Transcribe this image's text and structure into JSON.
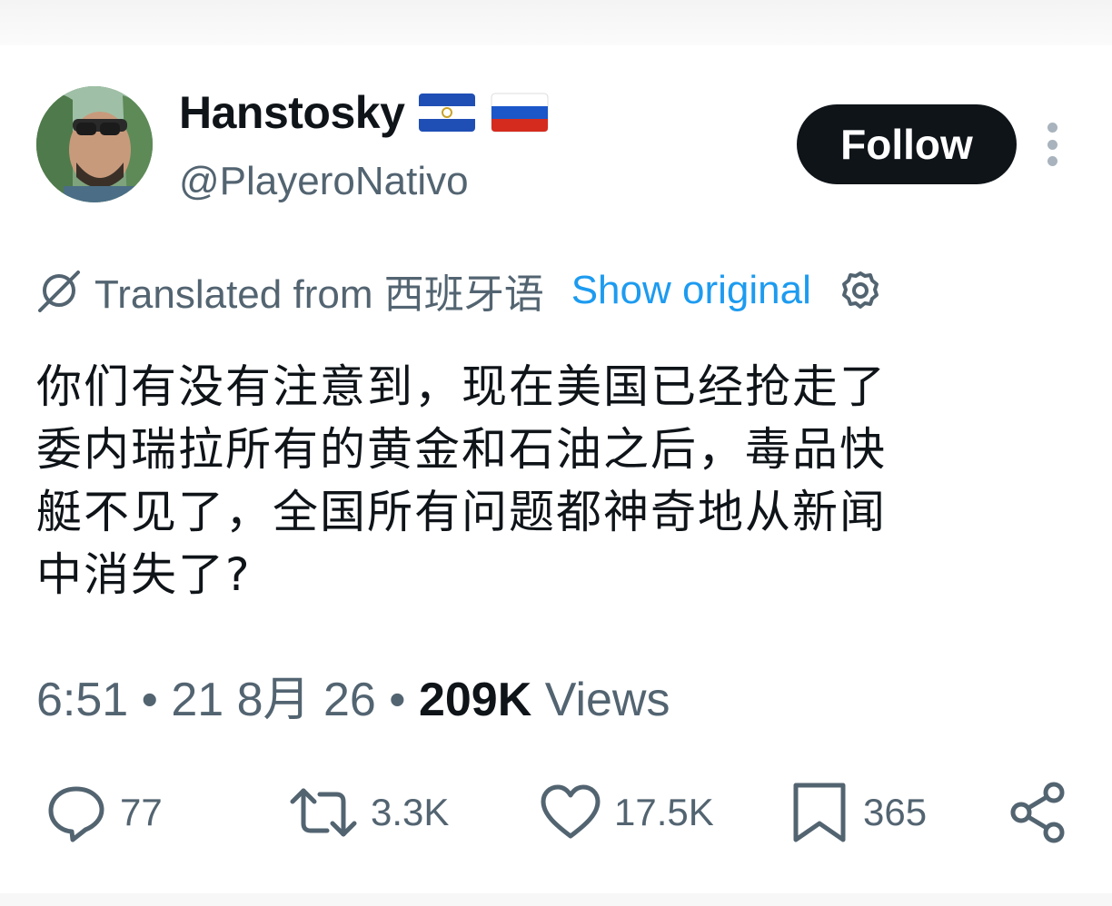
{
  "author": {
    "display_name": "Hanstosky",
    "handle": "@PlayeroNativo",
    "flags": [
      "El Salvador flag",
      "Russia flag"
    ]
  },
  "follow_button": {
    "label": "Follow"
  },
  "translation": {
    "label": "Translated from 西班牙语",
    "show_original": "Show original"
  },
  "tweet": {
    "lines": [
      "你们有没有注意到，现在美国已经抢走了",
      "委内瑞拉所有的黄金和石油之后，毒品快",
      "艇不见了，全国所有问题都神奇地从新闻",
      "中消失了?"
    ]
  },
  "meta": {
    "time": "6:51",
    "sep1": " • ",
    "date": "21 8月 26",
    "sep2": " • ",
    "views_count": "209K",
    "views_label": " Views"
  },
  "actions": {
    "replies": "77",
    "reposts": "3.3K",
    "likes": "17.5K",
    "bookmarks": "365"
  },
  "colors": {
    "text_primary": "#0f1419",
    "text_secondary": "#536471",
    "link_blue": "#1d9bf0",
    "button_black": "#0f1419"
  }
}
